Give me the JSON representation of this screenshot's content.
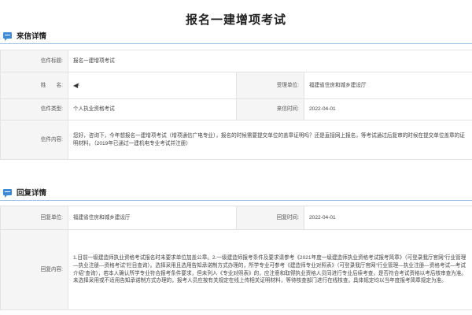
{
  "page": {
    "title": "报名一建增项考试"
  },
  "letter": {
    "section_title": "来信详情",
    "subject_label": "信件标题:",
    "subject_value": "报名一建增项考试",
    "name_label": "姓　　名:",
    "name_value_icon": "speaker-icon",
    "receiver_label": "受理单位:",
    "receiver_value": "福建省住房和城乡建设厅",
    "type_label": "信件类型:",
    "type_value": "个人执业资格考试",
    "date_label": "来信时间:",
    "date_value": "2022-04-01",
    "content_label": "信件内容:",
    "content_value": "您好，咨询下，今年想报名一建增项考试（增项通信广电专业），报名的时候需要提交单位的盖章证明吗？还是直接网上报名，等考试通过后复审的时候在提交单位盖章的证明材料。（2019年已通过一建机电专业考试并注册）"
  },
  "reply": {
    "section_title": "回复详情",
    "unit_label": "回复单位:",
    "unit_value": "福建省住房和城乡建设厅",
    "date_label": "回复时间:",
    "date_value": "2022-04-01",
    "content_label": "回复内容:",
    "content_value": "1.目前一级建造师执业资格考试报名时未要求单位加盖公章。2.一级建造师报考条件及要求请参考《2021年度一级建造师执业资格考试报考简章》（可登录我厅官网“行业管理—执业注册—资格考试”栏目查询）。选择采用且选用告知承诺制方式办理的，所学专业可参考《建造师专业对照表》（可登录我厅官网“行业管理—执业注册—资格考试—考试介绍”查询），若本人确认所学专业符合报考条件要求，但未列入《专业对照表》的，应注意和取得执业资格人员同进行专业后续考查，是否符合考试资格以考后核审查为准。未选择采用或不适用告知承诺制方式办理的，报考人员应按有关规定在线上传相关证明材料，等待核查部门进行在线核查。具体规定均以当年度报考简章规定为准。"
  },
  "colors": {
    "accent": "#3d8ad6",
    "divider": "#9cc3e6",
    "label_bg": "#f5f5f5",
    "border": "#e3e3e3"
  }
}
